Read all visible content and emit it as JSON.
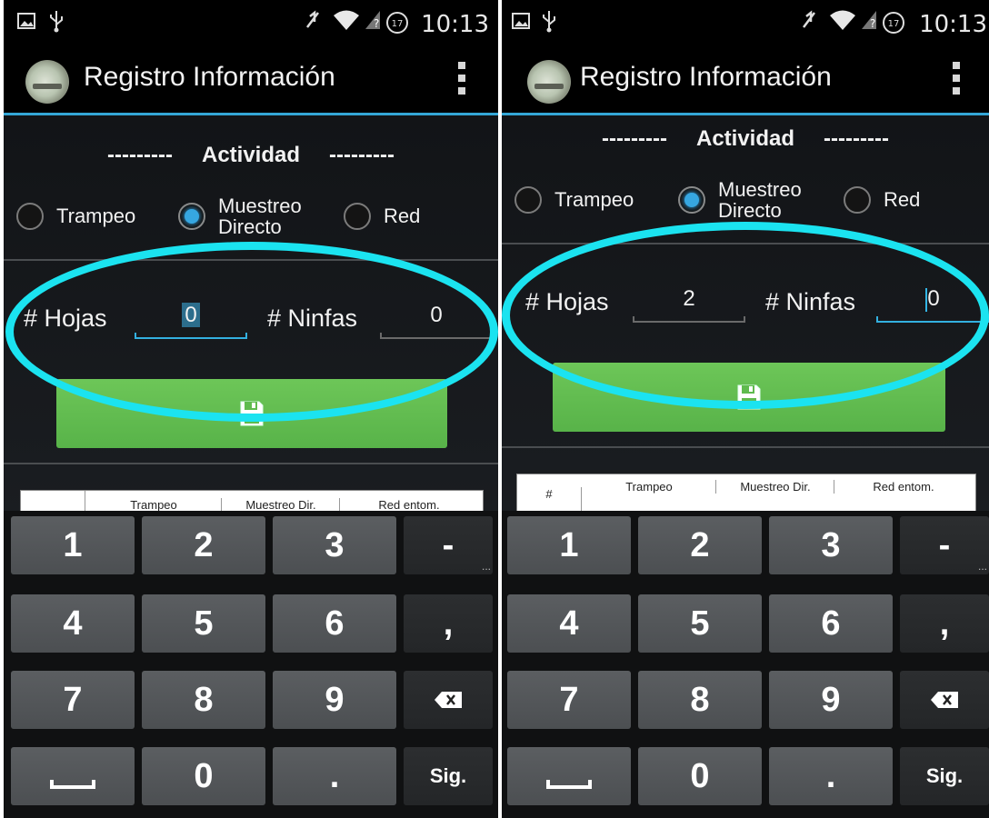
{
  "screens": [
    {
      "status": {
        "time": "10:13",
        "badge": "17"
      },
      "app_title": "Registro Información",
      "activity": {
        "dashes_left": "---------",
        "label": "Actividad",
        "dashes_right": "---------"
      },
      "radios": [
        {
          "label": "Trampeo",
          "checked": false
        },
        {
          "label_line1": "Muestreo",
          "label_line2": "Directo",
          "checked": true
        },
        {
          "label": "Red",
          "checked": false
        }
      ],
      "hojas": {
        "label": "# Hojas",
        "value": "0"
      },
      "ninfas": {
        "label": "# Ninfas",
        "value": "0"
      },
      "table": {
        "col_hash": "",
        "group1": "Trampeo",
        "group2": "Muestreo Dir.",
        "group3": "Red entom."
      }
    },
    {
      "status": {
        "time": "10:13",
        "badge": "17"
      },
      "app_title": "Registro Información",
      "activity": {
        "dashes_left": "---------",
        "label": "Actividad",
        "dashes_right": "---------"
      },
      "radios": [
        {
          "label": "Trampeo",
          "checked": false
        },
        {
          "label_line1": "Muestreo",
          "label_line2": "Directo",
          "checked": true
        },
        {
          "label": "Red",
          "checked": false
        }
      ],
      "hojas": {
        "label": "# Hojas",
        "value": "2"
      },
      "ninfas": {
        "label": "# Ninfas",
        "value": "0"
      },
      "table": {
        "col_hash": "#",
        "group1": "Trampeo",
        "group2": "Muestreo Dir.",
        "group3": "Red entom."
      }
    }
  ],
  "keyboard": {
    "row1": [
      "1",
      "2",
      "3",
      "-"
    ],
    "row1_more": "...",
    "row2": [
      "4",
      "5",
      "6",
      ","
    ],
    "row3": [
      "7",
      "8",
      "9"
    ],
    "row4": [
      "0",
      ".",
      "Sig."
    ]
  },
  "highlight_color": "#1be3f0",
  "accent_color": "#34a6d6",
  "save_button_color": "#5fbb4e"
}
